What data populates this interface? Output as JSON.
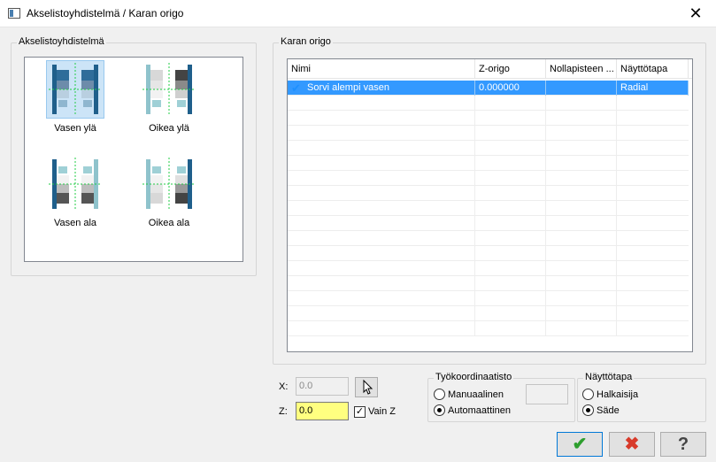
{
  "window": {
    "title": "Akselistoyhdistelmä / Karan origo",
    "close_label": "✕"
  },
  "left_group": {
    "legend": "Akselistoyhdistelmä",
    "options": [
      {
        "label": "Vasen ylä",
        "selected": true
      },
      {
        "label": "Oikea ylä",
        "selected": false
      },
      {
        "label": "Vasen ala",
        "selected": false
      },
      {
        "label": "Oikea ala",
        "selected": false
      }
    ]
  },
  "right_group": {
    "legend": "Karan origo",
    "columns": [
      "Nimi",
      "Z-origo",
      "Nollapisteen ...",
      "Näyttötapa"
    ],
    "rows": [
      {
        "name": "Sorvi alempi vasen",
        "z_origo": "0.000000",
        "nollapiste": "",
        "nayttotapa": "Radial",
        "selected": true
      }
    ]
  },
  "coords": {
    "x_label": "X:",
    "x_value": "0.0",
    "z_label": "Z:",
    "z_value": "0.0",
    "only_z_label": "Vain Z",
    "only_z_checked": true
  },
  "work_coords": {
    "legend": "Työkoordinaatisto",
    "manual_label": "Manuaalinen",
    "auto_label": "Automaattinen",
    "selected": "auto"
  },
  "display_mode": {
    "legend": "Näyttötapa",
    "diameter_label": "Halkaisija",
    "radius_label": "Säde",
    "selected": "radius"
  },
  "buttons": {
    "ok_symbol": "✔",
    "cancel_symbol": "✖",
    "help_symbol": "?"
  },
  "colors": {
    "selection": "#3399ff",
    "ok_green": "#2e9e2e",
    "cancel_red": "#d83a2a",
    "z_field": "#ffff80"
  }
}
